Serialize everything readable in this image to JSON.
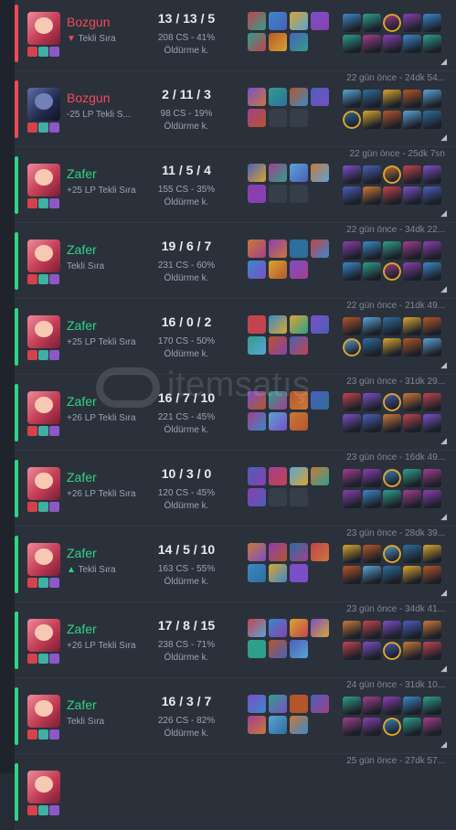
{
  "matches": [
    {
      "outcome": "loss",
      "result": "Bozgun",
      "queue": "Tekli Sıra",
      "lp_change": "",
      "rank_change": "down",
      "date": "",
      "kda": "13 / 13 / 5",
      "cs": "208 CS - 41% Öldürme k.",
      "champ_style": "light"
    },
    {
      "outcome": "loss",
      "result": "Bozgun",
      "queue": "Tekli S...",
      "lp_change": "-25 LP",
      "rank_change": "",
      "date": "22 gün önce - 24dk 54...",
      "kda": "2 / 11 / 3",
      "cs": "98 CS - 19% Öldürme k.",
      "champ_style": "dark"
    },
    {
      "outcome": "win",
      "result": "Zafer",
      "queue": "Tekli Sıra",
      "lp_change": "+25 LP",
      "rank_change": "",
      "date": "22 gün önce - 25dk 7sn",
      "kda": "11 / 5 / 4",
      "cs": "155 CS - 35% Öldürme k.",
      "champ_style": "light"
    },
    {
      "outcome": "win",
      "result": "Zafer",
      "queue": "Tekli Sıra",
      "lp_change": "",
      "rank_change": "",
      "date": "22 gün önce - 34dk 22...",
      "kda": "19 / 6 / 7",
      "cs": "231 CS - 60% Öldürme k.",
      "champ_style": "light"
    },
    {
      "outcome": "win",
      "result": "Zafer",
      "queue": "Tekli Sıra",
      "lp_change": "+25 LP",
      "rank_change": "",
      "date": "22 gün önce - 21dk 49...",
      "kda": "16 / 0 / 2",
      "cs": "170 CS - 50% Öldürme k.",
      "champ_style": "light"
    },
    {
      "outcome": "win",
      "result": "Zafer",
      "queue": "Tekli Sıra",
      "lp_change": "+26 LP",
      "rank_change": "",
      "date": "23 gün önce - 31dk 29...",
      "kda": "16 / 7 / 10",
      "cs": "221 CS - 45% Öldürme k.",
      "champ_style": "light"
    },
    {
      "outcome": "win",
      "result": "Zafer",
      "queue": "Tekli Sıra",
      "lp_change": "+26 LP",
      "rank_change": "",
      "date": "23 gün önce - 16dk 49...",
      "kda": "10 / 3 / 0",
      "cs": "120 CS - 45% Öldürme k.",
      "champ_style": "light"
    },
    {
      "outcome": "win",
      "result": "Zafer",
      "queue": "Tekli Sıra",
      "lp_change": "",
      "rank_change": "up",
      "date": "23 gün önce - 28dk 39...",
      "kda": "14 / 5 / 10",
      "cs": "163 CS - 55% Öldürme k.",
      "champ_style": "light"
    },
    {
      "outcome": "win",
      "result": "Zafer",
      "queue": "Tekli Sıra",
      "lp_change": "+26 LP",
      "rank_change": "",
      "date": "23 gün önce - 34dk 41...",
      "kda": "17 / 8 / 15",
      "cs": "238 CS - 71% Öldürme k.",
      "champ_style": "light"
    },
    {
      "outcome": "win",
      "result": "Zafer",
      "queue": "Tekli Sıra",
      "lp_change": "",
      "rank_change": "",
      "date": "24 gün önce - 31dk 10...",
      "kda": "16 / 3 / 7",
      "cs": "226 CS - 82% Öldürme k.",
      "champ_style": "light"
    },
    {
      "outcome": "win",
      "result": "",
      "queue": "",
      "lp_change": "",
      "rank_change": "",
      "date": "25 gün önce - 27dk 57...",
      "kda": "",
      "cs": "",
      "champ_style": "light"
    }
  ],
  "watermark": {
    "text": "itemsatış"
  },
  "colors": {
    "background": "#262c36",
    "win": "#2fd584",
    "loss": "#ee4b57"
  },
  "icons": {
    "expand": "expand-corner-icon",
    "rank_down": "triangle-down-icon",
    "rank_up": "triangle-up-icon"
  }
}
